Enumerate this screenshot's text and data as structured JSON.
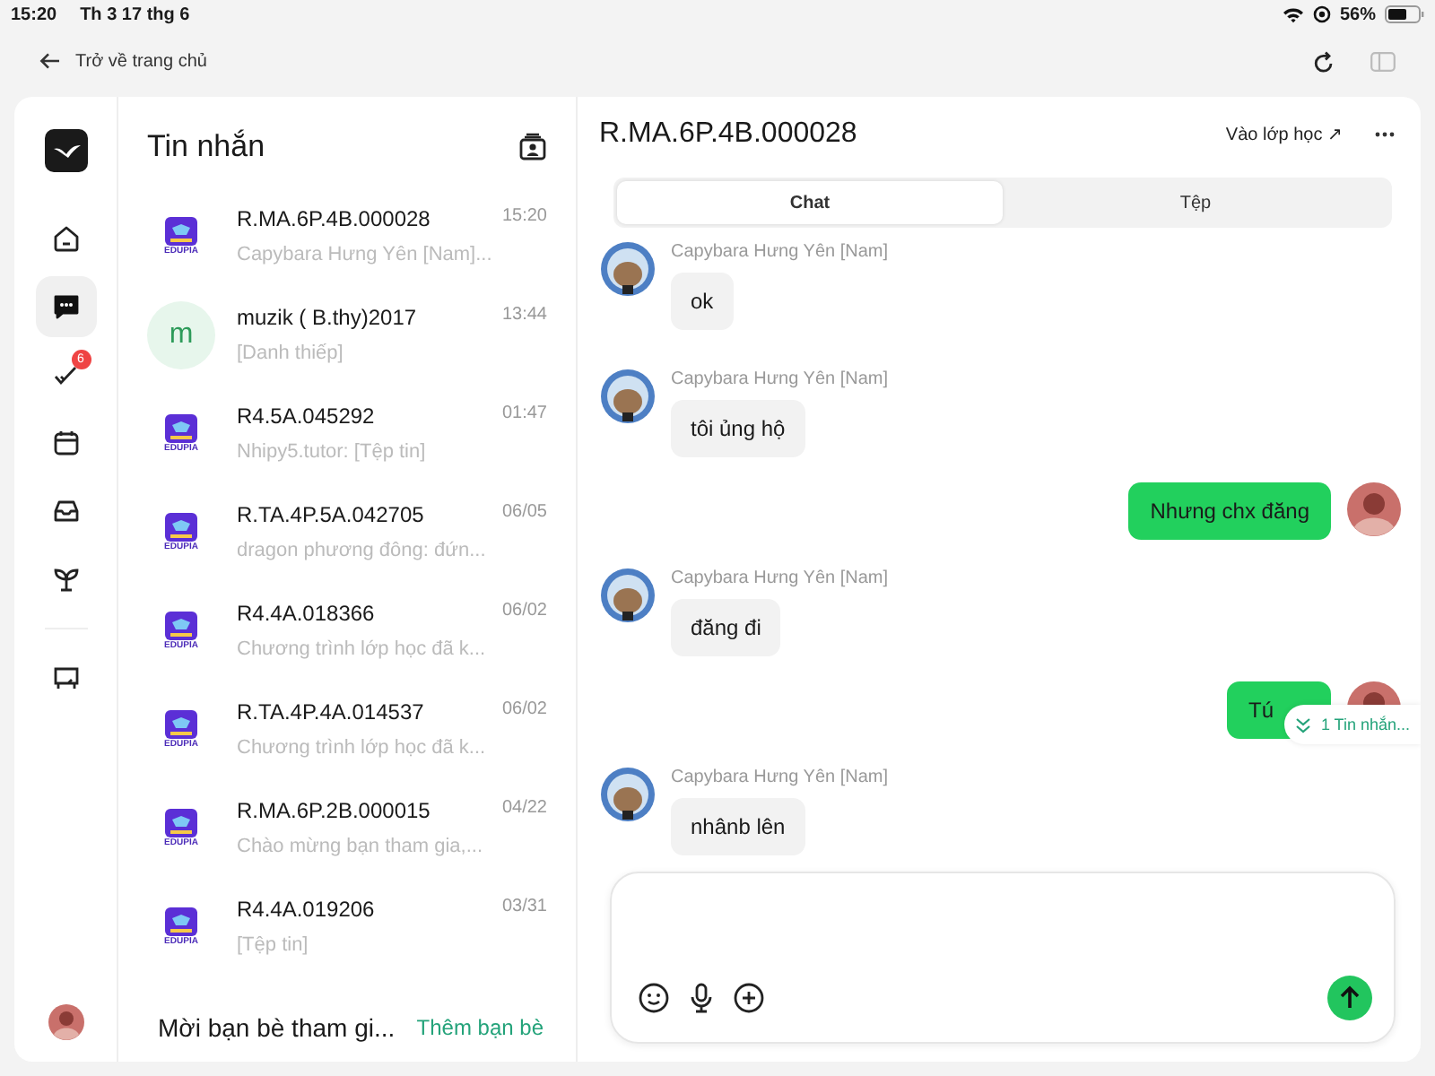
{
  "status_bar": {
    "time": "15:20",
    "date": "Th 3 17 thg 6",
    "battery": "56%"
  },
  "top_bar": {
    "back_label": "Trở về trang chủ"
  },
  "nav": {
    "items": [
      {
        "kind": "home",
        "selected": false
      },
      {
        "kind": "chat",
        "selected": true
      },
      {
        "kind": "tasks",
        "selected": false,
        "badge": "6"
      },
      {
        "kind": "calendar",
        "selected": false
      },
      {
        "kind": "inbox",
        "selected": false
      },
      {
        "kind": "sprout",
        "selected": false
      },
      {
        "kind": "board",
        "selected": false
      }
    ]
  },
  "conversations": {
    "title": "Tin nhắn",
    "items": [
      {
        "kind": "logo",
        "logo_text": "EDUPIA",
        "name": "R.MA.6P.4B.000028",
        "time": "15:20",
        "preview": "Capybara Hưng Yên [Nam]..."
      },
      {
        "kind": "letter",
        "letter": "m",
        "name": "muzik ( B.thy)2017",
        "time": "13:44",
        "preview": "[Danh thiếp]"
      },
      {
        "kind": "logo",
        "logo_text": "EDUPIA",
        "name": "R4.5A.045292",
        "time": "01:47",
        "preview": "Nhipy5.tutor: [Tệp tin]"
      },
      {
        "kind": "logo",
        "logo_text": "EDUPIA",
        "name": "R.TA.4P.5A.042705",
        "time": "06/05",
        "preview": "dragon phương đông: đứn..."
      },
      {
        "kind": "logo",
        "logo_text": "EDUPIA",
        "name": "R4.4A.018366",
        "time": "06/02",
        "preview": "Chương trình lớp học đã k..."
      },
      {
        "kind": "logo",
        "logo_text": "EDUPIA",
        "name": "R.TA.4P.4A.014537",
        "time": "06/02",
        "preview": "Chương trình lớp học đã k..."
      },
      {
        "kind": "logo",
        "logo_text": "EDUPIA",
        "name": "R.MA.6P.2B.000015",
        "time": "04/22",
        "preview": "Chào mừng bạn tham gia,..."
      },
      {
        "kind": "logo",
        "logo_text": "EDUPIA",
        "name": "R4.4A.019206",
        "time": "03/31",
        "preview": "[Tệp tin]"
      }
    ],
    "invite": "Mời bạn bè tham gi...",
    "add_friends": "Thêm bạn bè"
  },
  "chat": {
    "title": "R.MA.6P.4B.000028",
    "join_link": "Vào lớp học ↗",
    "tabs": [
      {
        "label": "Chat",
        "selected": true
      },
      {
        "label": "Tệp",
        "selected": false
      }
    ],
    "messages": [
      {
        "kind": "incoming",
        "sender": "Capybara Hưng Yên [Nam]",
        "text": "ok"
      },
      {
        "kind": "incoming",
        "sender": "Capybara Hưng Yên [Nam]",
        "text": "tôi ủng hộ"
      },
      {
        "kind": "outgoing",
        "text": "Nhưng chx đăng"
      },
      {
        "kind": "incoming",
        "sender": "Capybara Hưng Yên [Nam]",
        "text": "đăng đi"
      },
      {
        "kind": "outgoing",
        "text": "Tú"
      },
      {
        "kind": "incoming",
        "sender": "Capybara Hưng Yên [Nam]",
        "text": "nhânb lên"
      }
    ],
    "new_messages": "1 Tin nhắn..."
  }
}
